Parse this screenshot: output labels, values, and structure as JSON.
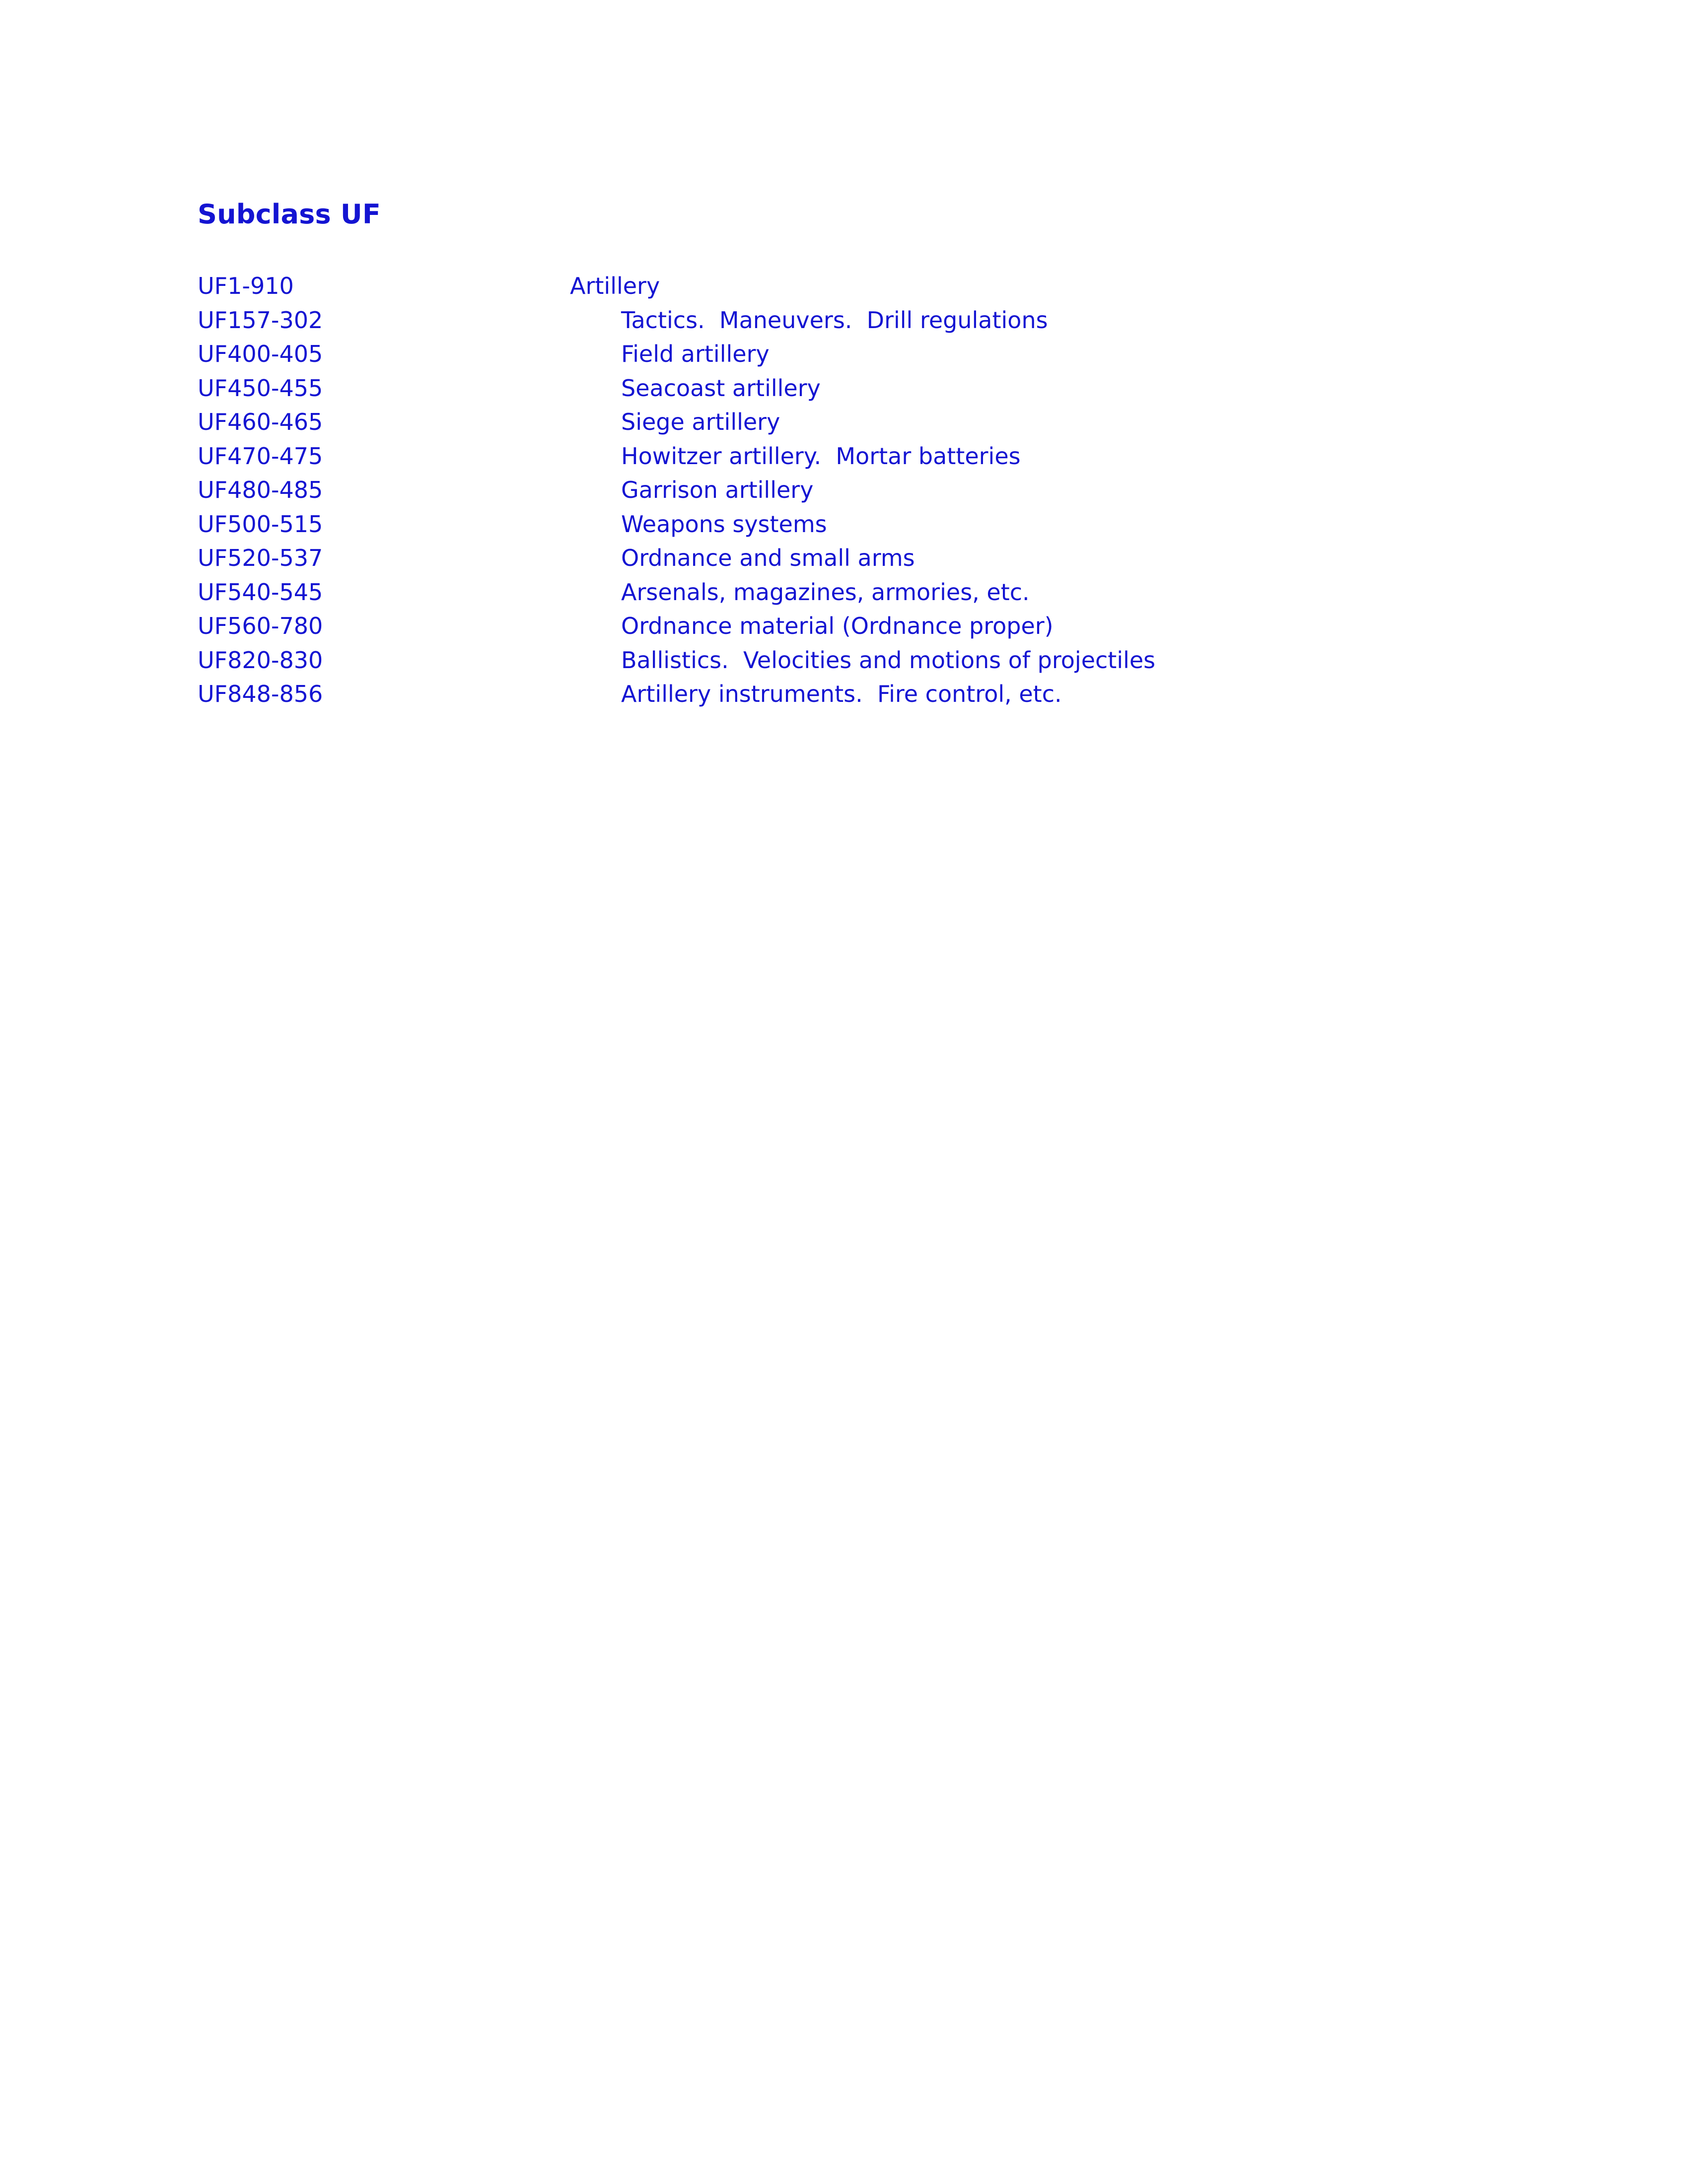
{
  "document": {
    "title": "Subclass UF",
    "text_color": "#1414d2",
    "background_color": "#ffffff"
  },
  "outline": {
    "rows": [
      {
        "range": "UF1-910",
        "caption": "Artillery",
        "indent": 1
      },
      {
        "range": "UF157-302",
        "caption": "Tactics.  Maneuvers.  Drill regulations",
        "indent": 2
      },
      {
        "range": "UF400-405",
        "caption": "Field artillery",
        "indent": 2
      },
      {
        "range": "UF450-455",
        "caption": "Seacoast artillery",
        "indent": 2
      },
      {
        "range": "UF460-465",
        "caption": "Siege artillery",
        "indent": 2
      },
      {
        "range": "UF470-475",
        "caption": "Howitzer artillery.  Mortar batteries",
        "indent": 2
      },
      {
        "range": "UF480-485",
        "caption": "Garrison artillery",
        "indent": 2
      },
      {
        "range": "UF500-515",
        "caption": "Weapons systems",
        "indent": 2
      },
      {
        "range": "UF520-537",
        "caption": "Ordnance and small arms",
        "indent": 2
      },
      {
        "range": "UF540-545",
        "caption": "Arsenals, magazines, armories, etc.",
        "indent": 2
      },
      {
        "range": "UF560-780",
        "caption": "Ordnance material (Ordnance proper)",
        "indent": 2
      },
      {
        "range": "UF820-830",
        "caption": "Ballistics.  Velocities and motions of projectiles",
        "indent": 2
      },
      {
        "range": "UF848-856",
        "caption": "Artillery instruments.  Fire control, etc.",
        "indent": 2
      }
    ]
  }
}
